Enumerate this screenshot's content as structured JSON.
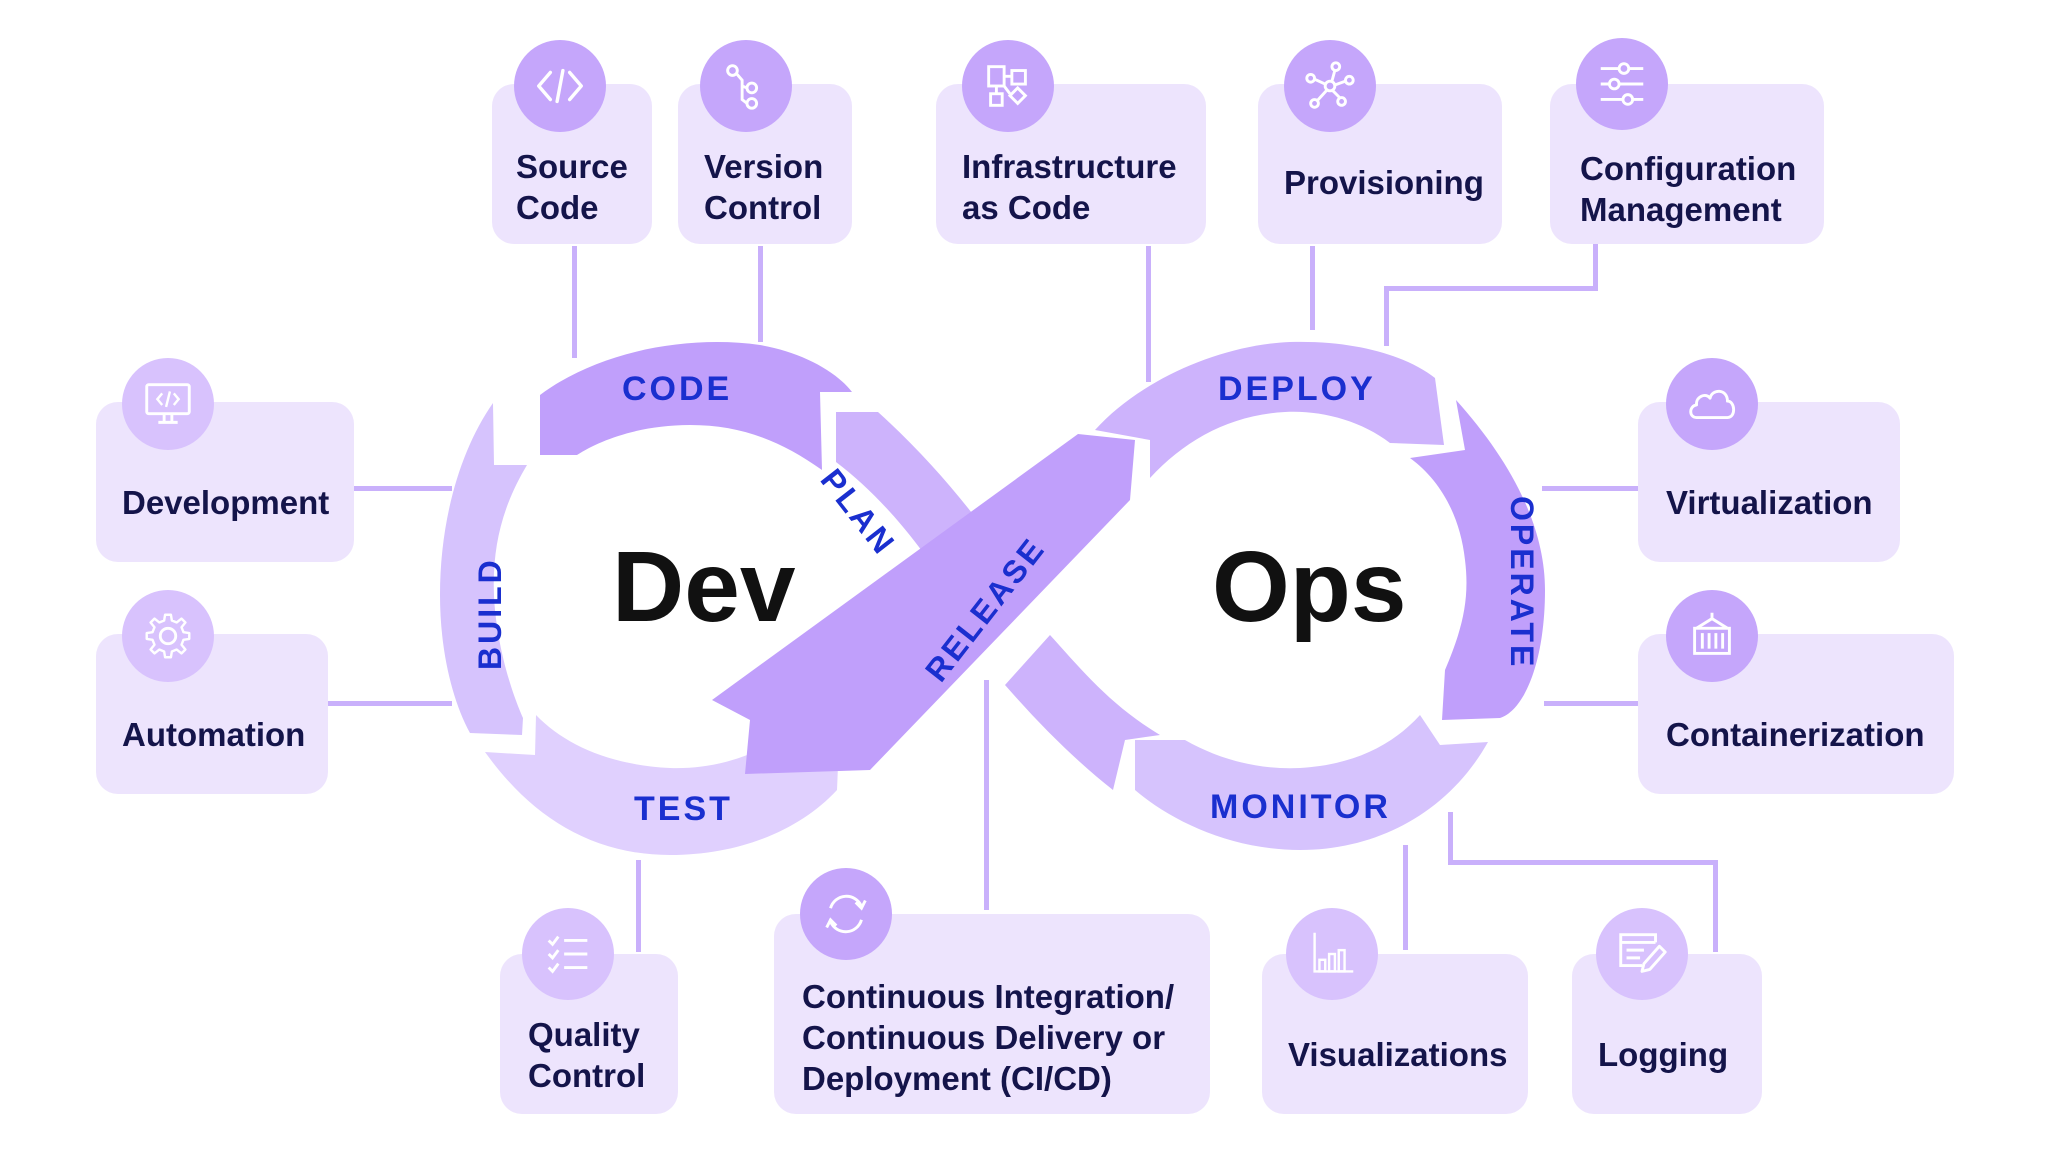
{
  "center": {
    "dev_label": "Dev",
    "ops_label": "Ops"
  },
  "stages": {
    "code": "CODE",
    "plan": "PLAN",
    "build": "BUILD",
    "test": "TEST",
    "release": "RELEASE",
    "deploy": "DEPLOY",
    "operate": "OPERATE",
    "monitor": "MONITOR"
  },
  "practices": {
    "source_code": {
      "label": "Source\nCode",
      "icon": "code-brackets-icon"
    },
    "version_control": {
      "label": "Version\nControl",
      "icon": "git-branch-icon"
    },
    "infrastructure_as_code": {
      "label": "Infrastructure\nas Code",
      "icon": "flowchart-icon"
    },
    "provisioning": {
      "label": "Provisioning",
      "icon": "network-hub-icon"
    },
    "configuration_management": {
      "label": "Configuration\nManagement",
      "icon": "sliders-icon"
    },
    "development": {
      "label": "Development",
      "icon": "monitor-code-icon"
    },
    "automation": {
      "label": "Automation",
      "icon": "gear-icon"
    },
    "virtualization": {
      "label": "Virtualization",
      "icon": "cloud-icon"
    },
    "containerization": {
      "label": "Containerization",
      "icon": "shipping-container-icon"
    },
    "quality_control": {
      "label": "Quality\nControl",
      "icon": "checklist-icon"
    },
    "cicd": {
      "label": "Continuous Integration/\nContinuous Delivery or\nDeployment (CI/CD)",
      "icon": "refresh-cycle-icon"
    },
    "visualizations": {
      "label": "Visualizations",
      "icon": "bar-chart-icon"
    },
    "logging": {
      "label": "Logging",
      "icon": "log-edit-icon"
    }
  },
  "colors": {
    "card_bg": "#ede4fd",
    "icon_bg": "#c5a6fb",
    "stage_dark": "#c09ffb",
    "stage_mid": "#cdb3fc",
    "stage_light": "#dfcffd",
    "stage_text": "#1a2fcf",
    "label_text": "#14144a",
    "connector": "#c9b0fb"
  }
}
